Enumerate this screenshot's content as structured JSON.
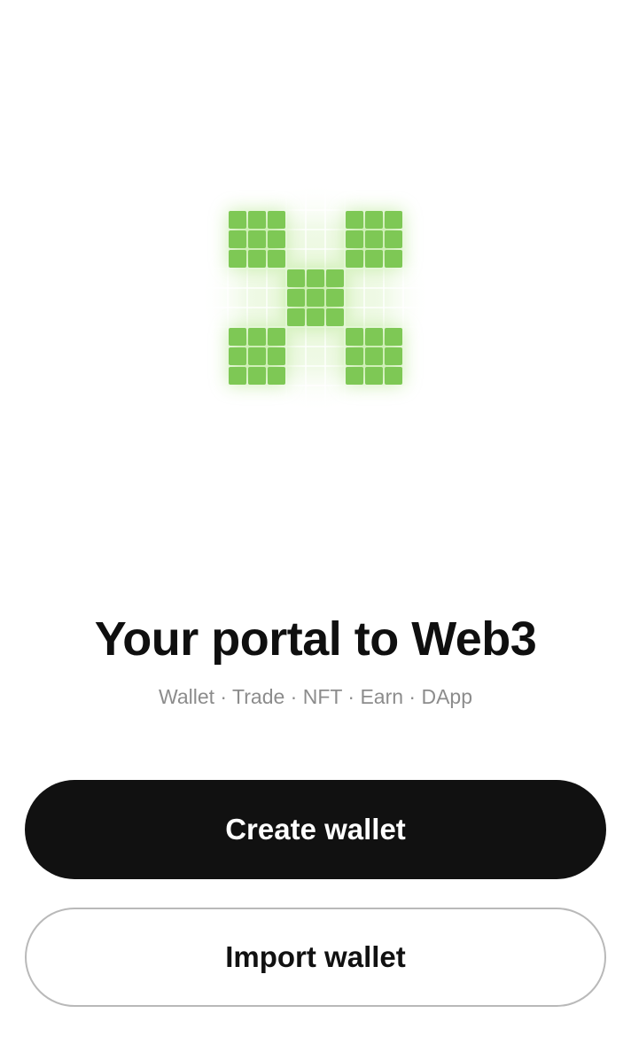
{
  "logo": {
    "icon": "okx-pixel-x-logo",
    "color": "#7ec855",
    "glow": "#a8e27c"
  },
  "headline": "Your portal to Web3",
  "subline": "Wallet · Trade · NFT · Earn · DApp",
  "buttons": {
    "create_label": "Create wallet",
    "import_label": "Import wallet"
  }
}
